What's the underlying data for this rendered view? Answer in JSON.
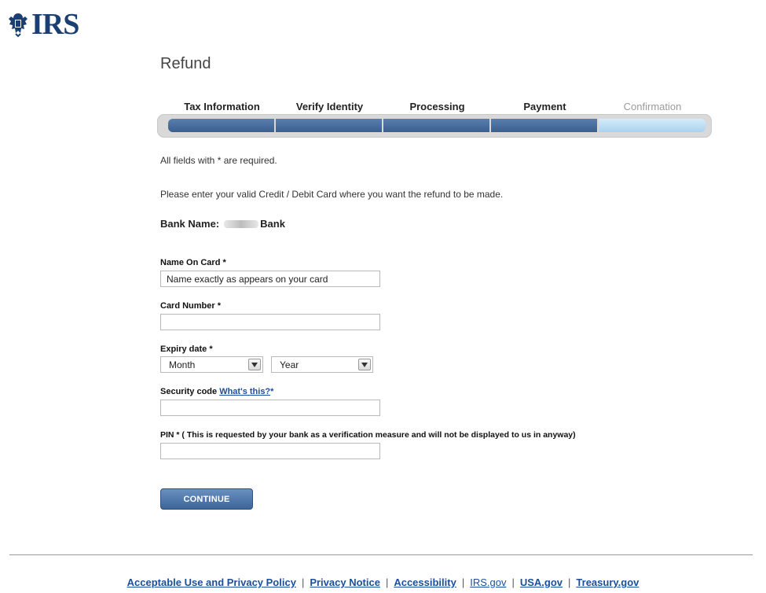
{
  "logo": {
    "text": "IRS"
  },
  "page_title": "Refund",
  "steps": [
    {
      "label": "Tax Information",
      "state": "done"
    },
    {
      "label": "Verify Identity",
      "state": "done"
    },
    {
      "label": "Processing",
      "state": "done"
    },
    {
      "label": "Payment",
      "state": "done"
    },
    {
      "label": "Confirmation",
      "state": "pending"
    }
  ],
  "required_note": "All fields with * are required.",
  "instruction": "Please enter your valid Credit / Debit Card where you want the refund to be made.",
  "bank": {
    "label": "Bank Name:",
    "name_suffix": "Bank"
  },
  "form": {
    "name_on_card": {
      "label": "Name On Card *",
      "value": "Name exactly as appears on your card"
    },
    "card_number": {
      "label": "Card Number *",
      "value": ""
    },
    "expiry": {
      "label": "Expiry date *",
      "month": "Month",
      "year": "Year"
    },
    "security_code": {
      "label": "Security code",
      "help_link": "What's this?",
      "required_mark": "*",
      "value": ""
    },
    "pin": {
      "label": "PIN * ( This is requested by your bank as a verification measure and will not be displayed to us in anyway)",
      "value": ""
    }
  },
  "continue_label": "CONTINUE",
  "footer_links": [
    {
      "label": "Acceptable Use and Privacy Policy",
      "style": "bold"
    },
    {
      "label": "Privacy Notice",
      "style": "bold"
    },
    {
      "label": "Accessibility",
      "style": "bold"
    },
    {
      "label": "IRS.gov",
      "style": "plain"
    },
    {
      "label": "USA.gov",
      "style": "bold"
    },
    {
      "label": "Treasury.gov",
      "style": "bold"
    }
  ],
  "colors": {
    "brand": "#1b3e73",
    "progress": "#3a5f8f",
    "progress_pending": "#a9d2ef",
    "link": "#1a4f9c"
  },
  "icons": {
    "logo": "eagle-seal-icon",
    "select_arrow": "chevron-down-icon"
  }
}
